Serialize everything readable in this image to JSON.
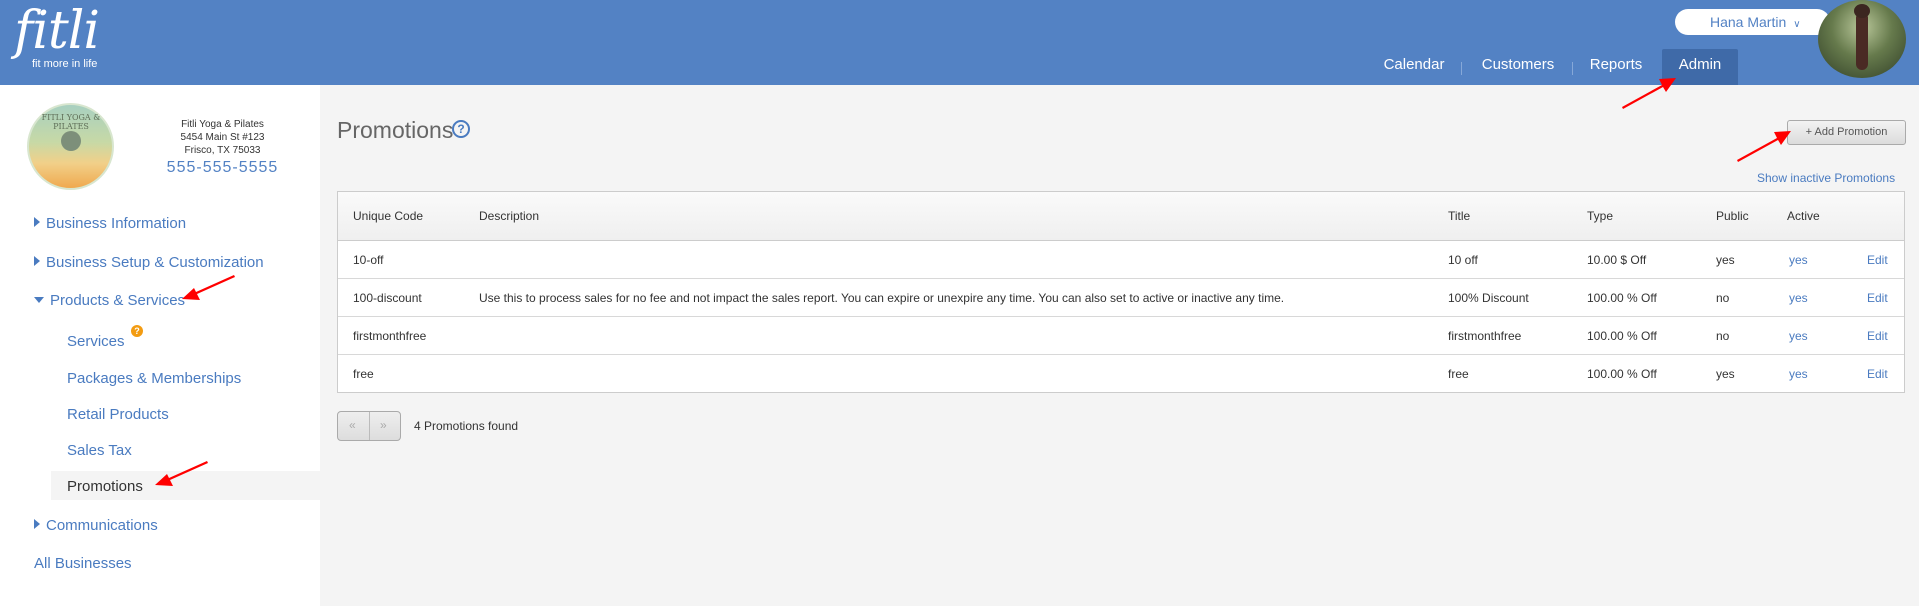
{
  "header": {
    "logo_word": "fitli",
    "logo_tagline": "fit more in life",
    "user_name": "Hana Martin",
    "nav": [
      "Calendar",
      "Customers",
      "Reports",
      "Admin"
    ],
    "active_nav": "Admin"
  },
  "business": {
    "logo_text": "FITLI YOGA & PILATES",
    "name": "Fitli Yoga & Pilates",
    "address": "5454 Main St #123",
    "city": "Frisco, TX 75033",
    "phone": "555-555-5555"
  },
  "sidebar": {
    "business_information": "Business Information",
    "business_setup": "Business Setup & Customization",
    "products_services": "Products & Services",
    "services": "Services",
    "services_badge": "?",
    "packages": "Packages & Memberships",
    "retail": "Retail Products",
    "sales_tax": "Sales Tax",
    "promotions": "Promotions",
    "communications": "Communications",
    "all_businesses": "All Businesses"
  },
  "main": {
    "title": "Promotions",
    "help": "?",
    "add_button": "+ Add Promotion",
    "show_inactive": "Show inactive Promotions",
    "columns": [
      "Unique Code",
      "Description",
      "Title",
      "Type",
      "Public",
      "Active",
      ""
    ],
    "rows": [
      {
        "code": "10-off",
        "description": "",
        "title": "10 off",
        "type": "10.00 $ Off",
        "public": "yes",
        "active": "yes",
        "action": "Edit"
      },
      {
        "code": "100-discount",
        "description": "Use this to process sales for no fee and not impact the sales report. You can expire or unexpire any time. You can also set to active or inactive any time.",
        "title": "100% Discount",
        "type": "100.00 % Off",
        "public": "no",
        "active": "yes",
        "action": "Edit"
      },
      {
        "code": "firstmonthfree",
        "description": "",
        "title": "firstmonthfree",
        "type": "100.00 % Off",
        "public": "no",
        "active": "yes",
        "action": "Edit"
      },
      {
        "code": "free",
        "description": "",
        "title": "free",
        "type": "100.00 % Off",
        "public": "yes",
        "active": "yes",
        "action": "Edit"
      }
    ],
    "pager_prev": "«",
    "pager_next": "»",
    "found_text": "4 Promotions found"
  },
  "colors": {
    "header": "#5382c4",
    "link": "#4a7bc0",
    "arrow": "#ff0000"
  }
}
